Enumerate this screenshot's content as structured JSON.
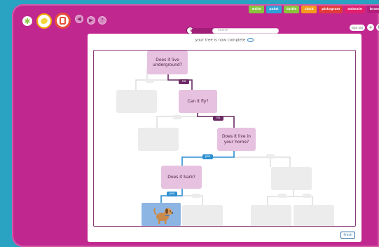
{
  "tabs": [
    {
      "label": "write",
      "color": "#8ac43f"
    },
    {
      "label": "paint",
      "color": "#2fa0d8"
    },
    {
      "label": "turtle",
      "color": "#8ac43f"
    },
    {
      "label": "clock",
      "color": "#f49a1c"
    },
    {
      "label": "pictogram",
      "color": "#e23b3b"
    },
    {
      "label": "animate",
      "color": "#e2206f"
    },
    {
      "label": "branch",
      "color": "#b21f7c"
    }
  ],
  "search": {
    "placeholder": "search"
  },
  "header": {
    "signout": "sign out"
  },
  "tree": {
    "status": "your tree is now complete",
    "questions": [
      "Does it live underground?",
      "Can it fly?",
      "Does it live in your home?",
      "Does it bark?"
    ],
    "answers": {
      "no": "no",
      "yes": "yes"
    },
    "result": "dog"
  },
  "footer": {
    "finish": "finish"
  },
  "colors": {
    "background": "#2aa3c2",
    "frame": "#c0288f",
    "question": "#e7c2e0",
    "no_branch": "#6a2a64",
    "yes_branch": "#2b8fd0"
  }
}
